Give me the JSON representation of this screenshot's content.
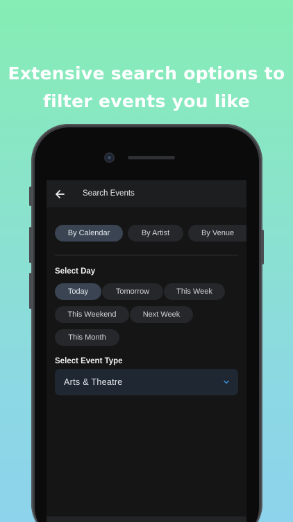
{
  "promo": {
    "headline_line1": "Extensive search options to",
    "headline_line2": "filter events you like"
  },
  "appbar": {
    "title": "Search Events",
    "back_icon": "arrow-left-icon"
  },
  "search_mode_tabs": [
    {
      "label": "By Calendar",
      "selected": true
    },
    {
      "label": "By Artist",
      "selected": false
    },
    {
      "label": "By Venue",
      "selected": false
    }
  ],
  "select_day": {
    "label": "Select Day",
    "options": [
      {
        "label": "Today",
        "selected": true
      },
      {
        "label": "Tomorrow",
        "selected": false
      },
      {
        "label": "This Week",
        "selected": false
      },
      {
        "label": "This Weekend",
        "selected": false
      },
      {
        "label": "Next Week",
        "selected": false
      },
      {
        "label": "This Month",
        "selected": false
      }
    ]
  },
  "select_event_type": {
    "label": "Select Event Type",
    "value": "Arts & Theatre",
    "icon": "chevron-down-icon"
  },
  "colors": {
    "background_top": "#86edb4",
    "background_bottom": "#8dd3ec",
    "chip_selected": "#3a4452",
    "chip_default": "#25272b",
    "dropdown_bg": "#1f2733",
    "chevron": "#3d8fd6"
  }
}
